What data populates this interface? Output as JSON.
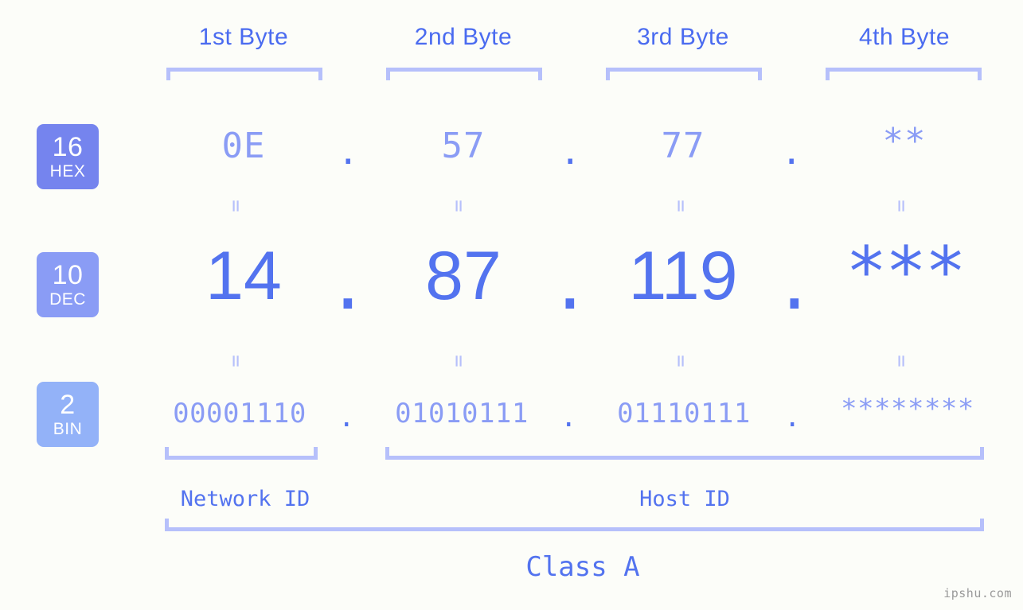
{
  "meta": {
    "background": "#fcfdf9",
    "accent_strong": "#5373ef",
    "accent_light": "#8a9cf5",
    "bracket": "#b6c0fb",
    "header_blue": "#4a6bf0",
    "watermark": "ipshu.com"
  },
  "headers": [
    {
      "label": "1st Byte"
    },
    {
      "label": "2nd Byte"
    },
    {
      "label": "3rd Byte"
    },
    {
      "label": "4th Byte"
    }
  ],
  "bases": [
    {
      "num": "16",
      "name": "HEX",
      "color": "#7584ee"
    },
    {
      "num": "10",
      "name": "DEC",
      "color": "#8a9cf5"
    },
    {
      "num": "2",
      "name": "BIN",
      "color": "#93b2f8"
    }
  ],
  "rows": {
    "hex": {
      "values": [
        "0E",
        "57",
        "77",
        "**"
      ]
    },
    "dec": {
      "values": [
        "14",
        "87",
        "119",
        "***"
      ]
    },
    "bin": {
      "values": [
        "00001110",
        "01010111",
        "01110111",
        "********"
      ]
    }
  },
  "separator": ".",
  "equals": "=",
  "footer": {
    "network_id": "Network ID",
    "host_id": "Host ID",
    "class": "Class A"
  }
}
